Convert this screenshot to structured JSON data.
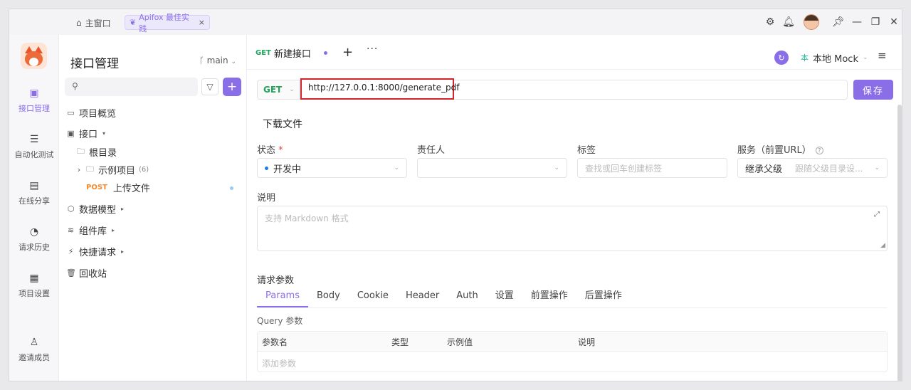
{
  "titlebar": {
    "home_label": "主窗口",
    "tab_label": "Apifox 最佳实践",
    "tab_close": "×",
    "icons": [
      "gear-icon",
      "bell-icon",
      "avatar",
      "pin-icon",
      "minimize-icon",
      "restore-icon",
      "close-icon"
    ]
  },
  "rail": {
    "items": [
      {
        "label": "接口管理",
        "icon": "api-icon"
      },
      {
        "label": "自动化测试",
        "icon": "automation-icon"
      },
      {
        "label": "在线分享",
        "icon": "share-icon"
      },
      {
        "label": "请求历史",
        "icon": "history-icon"
      },
      {
        "label": "项目设置",
        "icon": "settings-icon"
      },
      {
        "label": "邀请成员",
        "icon": "invite-icon"
      }
    ]
  },
  "sidebar": {
    "title": "接口管理",
    "branch": "main",
    "tree": {
      "overview": "项目概览",
      "apis": "接口",
      "root": "根目录",
      "example": "示例项目",
      "example_count": "(6)",
      "post_method": "POST",
      "upload": "上传文件",
      "models": "数据模型",
      "components": "组件库",
      "quick": "快捷请求",
      "trash": "回收站"
    }
  },
  "main": {
    "tab": {
      "method": "GET",
      "label": "新建接口"
    },
    "env": {
      "badge": "本",
      "label": "本地 Mock"
    },
    "request": {
      "method": "GET",
      "url": "http://127.0.0.1:8000/generate_pdf",
      "save": "保存"
    },
    "endpoint_name": "下载文件",
    "fields": {
      "status_label": "状态",
      "required_mark": "*",
      "status_value": "开发中",
      "owner_label": "责任人",
      "tag_label": "标签",
      "tag_placeholder": "查找或回车创建标签",
      "service_label": "服务（前置URL）",
      "service_inherit": "继承父级",
      "service_placeholder": "跟随父级目录设..."
    },
    "description": {
      "label": "说明",
      "placeholder": "支持 Markdown 格式"
    },
    "params": {
      "label": "请求参数",
      "tabs": [
        "Params",
        "Body",
        "Cookie",
        "Header",
        "Auth",
        "设置",
        "前置操作",
        "后置操作"
      ],
      "query_label": "Query 参数",
      "columns": [
        "参数名",
        "类型",
        "示例值",
        "说明"
      ],
      "add_placeholder": "添加参数"
    }
  }
}
